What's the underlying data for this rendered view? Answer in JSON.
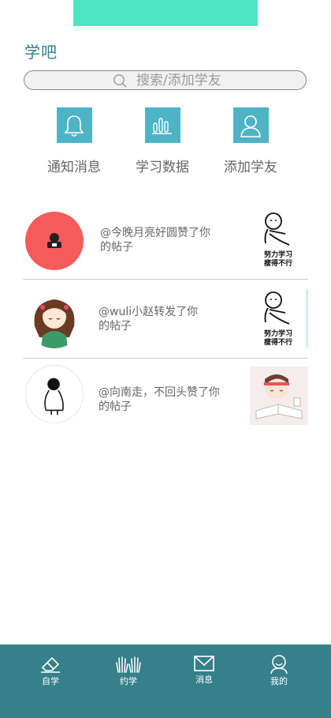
{
  "header": {
    "title": "学吧"
  },
  "search": {
    "placeholder": "搜索/添加学友"
  },
  "quick_actions": [
    {
      "label": "通知消息",
      "icon": "bell-icon"
    },
    {
      "label": "学习数据",
      "icon": "bar-chart-icon"
    },
    {
      "label": "添加学友",
      "icon": "user-icon"
    }
  ],
  "feed": [
    {
      "message": "@今晚月亮好圆赞了你的帖子",
      "thumb_text": [
        "努力学习",
        "瘦得不行"
      ]
    },
    {
      "message": "@wuli小赵转发了你的帖子",
      "thumb_text": [
        "努力学习",
        "瘦得不行"
      ]
    },
    {
      "message": "@向南走，不回头赞了你的帖子"
    }
  ],
  "tabbar": [
    {
      "label": "自学",
      "icon": "pencil-eraser-icon"
    },
    {
      "label": "约学",
      "icon": "hands-icon"
    },
    {
      "label": "消息",
      "icon": "envelope-icon"
    },
    {
      "label": "我的",
      "icon": "person-icon"
    }
  ],
  "colors": {
    "accent": "#4fb3c6",
    "tabbar": "#35808a",
    "top_bar": "#4de6c2",
    "title": "#2e7f8c"
  }
}
